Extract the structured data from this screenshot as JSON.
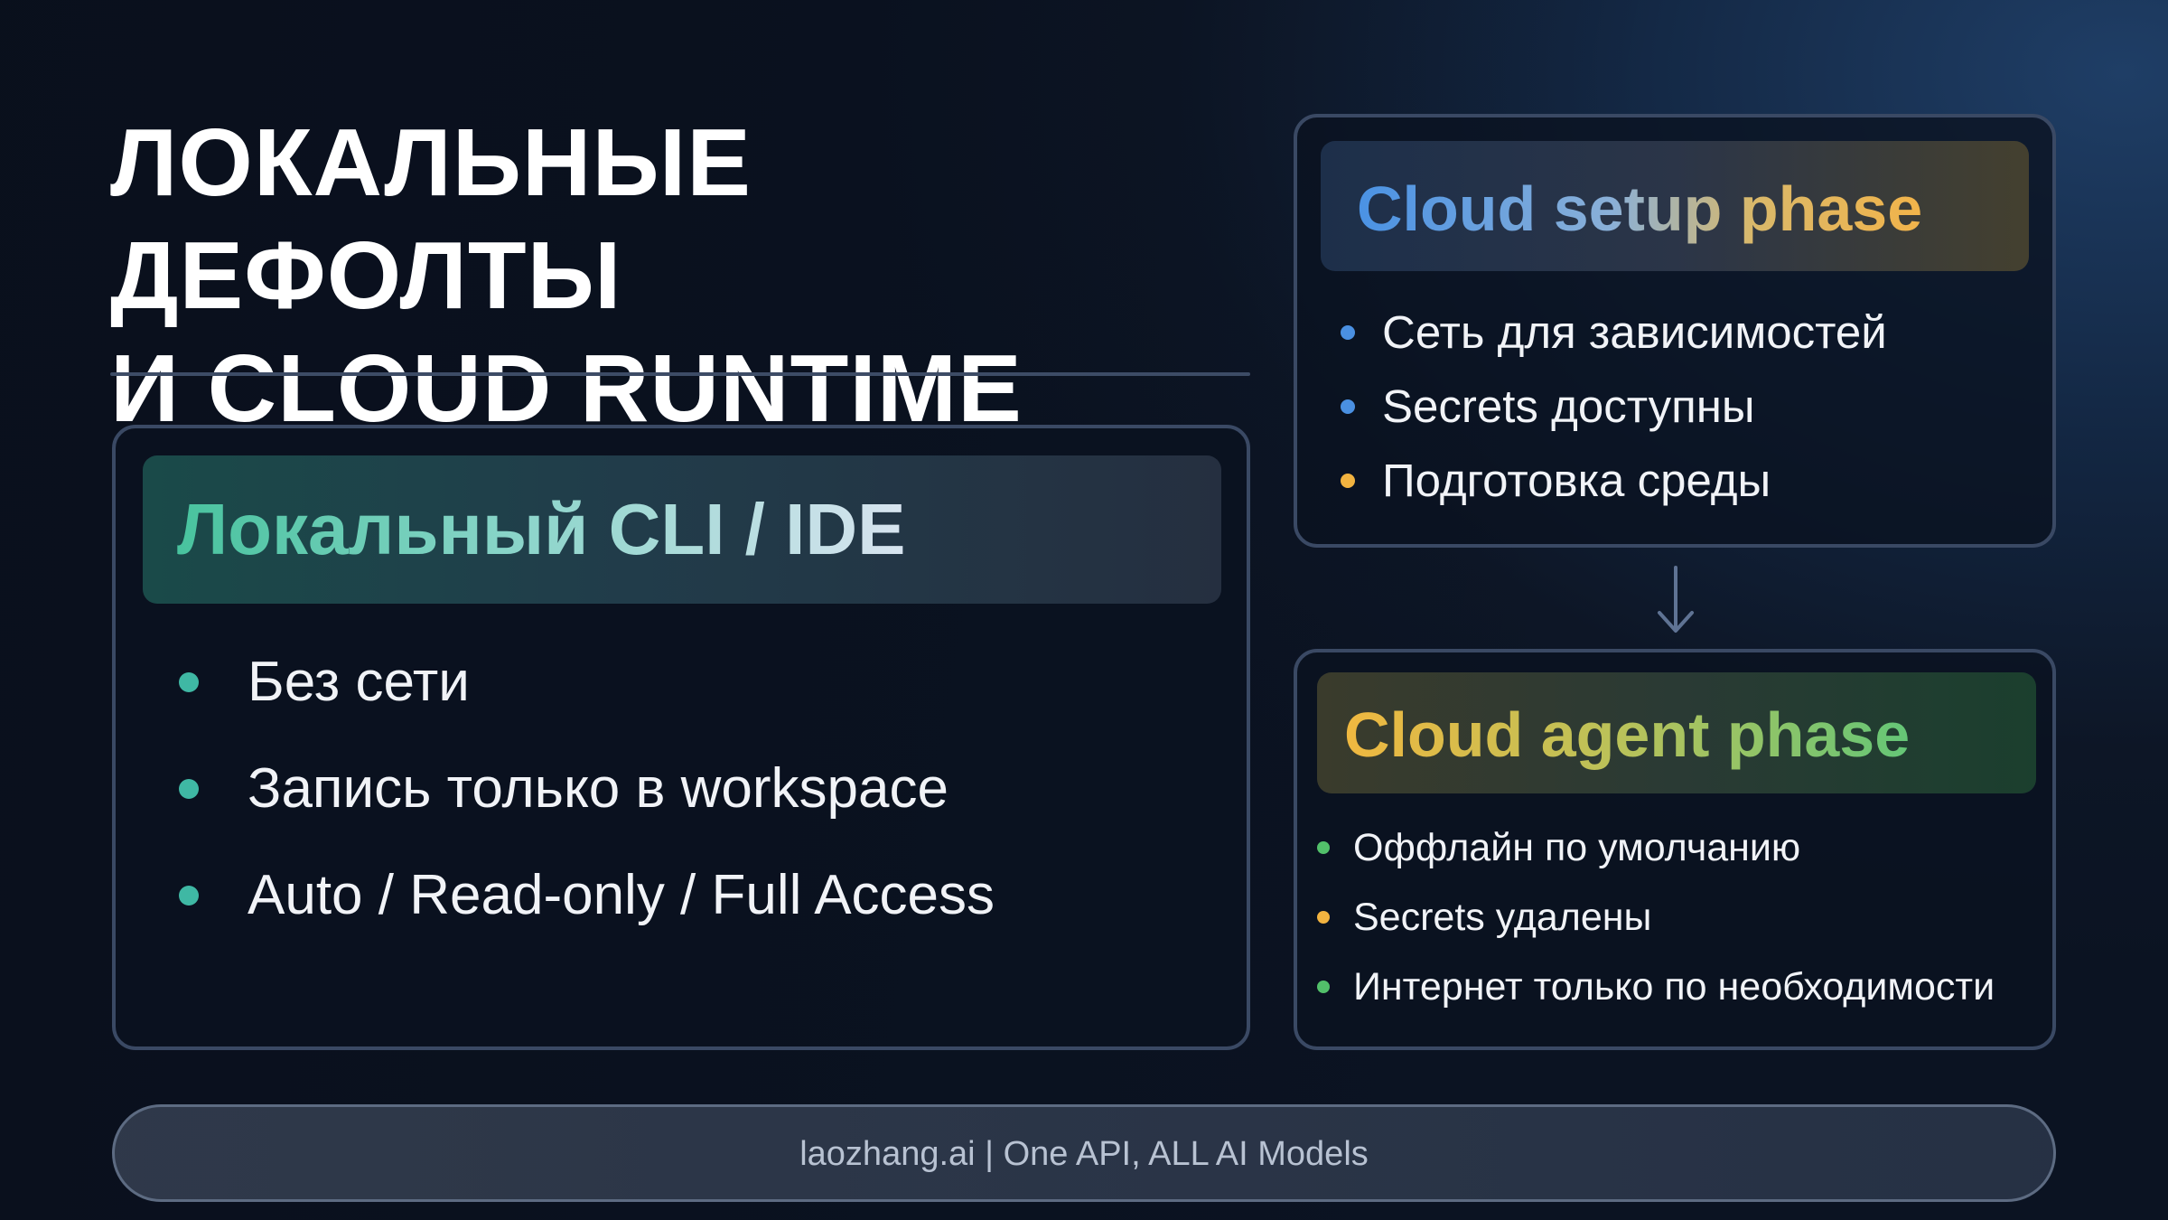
{
  "title": {
    "line1": "ЛОКАЛЬНЫЕ ДЕФОЛТЫ",
    "line2": "И CLOUD RUNTIME"
  },
  "local": {
    "header": "Локальный CLI / IDE",
    "items": [
      {
        "text": "Без сети",
        "dot_color": "#3fb8a4"
      },
      {
        "text": "Запись только в workspace",
        "dot_color": "#3fb8a4"
      },
      {
        "text": "Auto / Read-only / Full Access",
        "dot_color": "#3fb8a4"
      }
    ]
  },
  "setup": {
    "header": "Cloud setup phase",
    "items": [
      {
        "text": "Сеть для зависимостей",
        "dot_color": "#4a90e2"
      },
      {
        "text": "Secrets доступны",
        "dot_color": "#4a90e2"
      },
      {
        "text": "Подготовка среды",
        "dot_color": "#f2b340"
      }
    ]
  },
  "agent": {
    "header": "Cloud agent phase",
    "items": [
      {
        "text": "Оффлайн по умолчанию",
        "dot_color": "#52c06a"
      },
      {
        "text": "Secrets удалены",
        "dot_color": "#f2b340"
      },
      {
        "text": "Интернет только по необходимости",
        "dot_color": "#52c06a"
      }
    ]
  },
  "arrow_icon": "arrow-down-icon",
  "footer": {
    "text": "laozhang.ai | One API, ALL AI Models"
  },
  "colors": {
    "background": "#0d1626",
    "card_border": "#3a4964",
    "teal_accent": "#3fb8a4",
    "blue_accent": "#4a90e2",
    "amber_accent": "#f2b340",
    "green_accent": "#52c06a"
  }
}
